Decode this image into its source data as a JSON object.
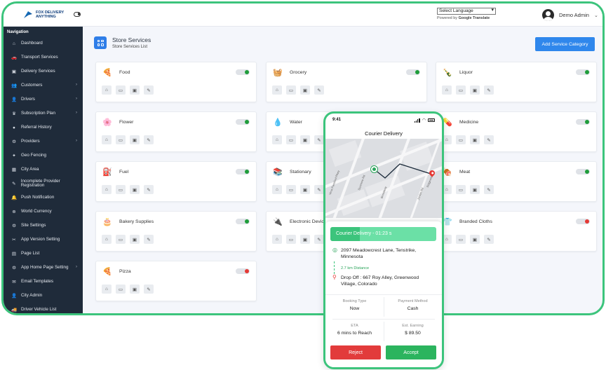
{
  "brand": {
    "logo_text": "FOX DELIVERY ANYTHING"
  },
  "header": {
    "language_select": "Select Language",
    "powered_by": "Powered by",
    "google_translate": "Google Translate",
    "user_name": "Demo Admin"
  },
  "sidebar": {
    "title": "Navigation",
    "items": [
      {
        "label": "Dashboard",
        "icon": "home-icon",
        "glyph": "⌂",
        "chevron": false
      },
      {
        "label": "Transport Services",
        "icon": "car-icon",
        "glyph": "🚗",
        "chevron": false
      },
      {
        "label": "Delivery Services",
        "icon": "box-icon",
        "glyph": "▣",
        "chevron": false
      },
      {
        "label": "Customers",
        "icon": "users-icon",
        "glyph": "👥",
        "chevron": true
      },
      {
        "label": "Drivers",
        "icon": "driver-icon",
        "glyph": "👤",
        "chevron": true
      },
      {
        "label": "Subscription Plan",
        "icon": "plan-icon",
        "glyph": "♛",
        "chevron": true
      },
      {
        "label": "Referral History",
        "icon": "referral-icon",
        "glyph": "●",
        "chevron": false
      },
      {
        "label": "Providers",
        "icon": "providers-icon",
        "glyph": "⚙",
        "chevron": true
      },
      {
        "label": "Geo Fencing",
        "icon": "geofence-icon",
        "glyph": "✦",
        "chevron": false
      },
      {
        "label": "City Area",
        "icon": "city-icon",
        "glyph": "▦",
        "chevron": false
      },
      {
        "label": "Incomplete Provider Registration",
        "icon": "incomplete-icon",
        "glyph": "✎",
        "chevron": false
      },
      {
        "label": "Push Notification",
        "icon": "bell-icon",
        "glyph": "🔔",
        "chevron": false
      },
      {
        "label": "World Currency",
        "icon": "currency-icon",
        "glyph": "⊕",
        "chevron": false
      },
      {
        "label": "Site Settings",
        "icon": "settings-icon",
        "glyph": "⚙",
        "chevron": false
      },
      {
        "label": "App Version Setting",
        "icon": "version-icon",
        "glyph": "✂",
        "chevron": false
      },
      {
        "label": "Page List",
        "icon": "page-icon",
        "glyph": "▤",
        "chevron": false
      },
      {
        "label": "App Home Page Setting",
        "icon": "app-home-icon",
        "glyph": "⚙",
        "chevron": true
      },
      {
        "label": "Email Templates",
        "icon": "email-icon",
        "glyph": "✉",
        "chevron": false
      },
      {
        "label": "City Admin",
        "icon": "city-admin-icon",
        "glyph": "👤",
        "chevron": false
      },
      {
        "label": "Driver Vehicle List",
        "icon": "vehicle-icon",
        "glyph": "🚚",
        "chevron": false
      }
    ]
  },
  "page": {
    "title": "Store Services",
    "subtitle": "Store Services List",
    "add_button": "Add Service Category"
  },
  "services": [
    {
      "name": "Food",
      "icon": "food-icon",
      "glyph": "🍕",
      "enabled": true
    },
    {
      "name": "Grocery",
      "icon": "grocery-icon",
      "glyph": "🧺",
      "enabled": true
    },
    {
      "name": "Liquor",
      "icon": "liquor-icon",
      "glyph": "🍾",
      "enabled": true
    },
    {
      "name": "Flower",
      "icon": "flower-icon",
      "glyph": "🌸",
      "enabled": true
    },
    {
      "name": "Water",
      "icon": "water-icon",
      "glyph": "💧",
      "enabled": true
    },
    {
      "name": "Medicine",
      "icon": "medicine-icon",
      "glyph": "💊",
      "enabled": true
    },
    {
      "name": "Fuel",
      "icon": "fuel-icon",
      "glyph": "⛽",
      "enabled": true
    },
    {
      "name": "Stationary",
      "icon": "stationary-icon",
      "glyph": "📚",
      "enabled": true
    },
    {
      "name": "Meat",
      "icon": "meat-icon",
      "glyph": "🍖",
      "enabled": true
    },
    {
      "name": "Bakery Supplies",
      "icon": "bakery-icon",
      "glyph": "🎂",
      "enabled": true
    },
    {
      "name": "Electronic Device",
      "icon": "electronic-icon",
      "glyph": "🔌",
      "enabled": true
    },
    {
      "name": "Branded Cloths",
      "icon": "cloths-icon",
      "glyph": "👕",
      "enabled": false
    },
    {
      "name": "Pizza",
      "icon": "pizza-icon",
      "glyph": "🍕",
      "enabled": false
    }
  ],
  "card_actions": [
    {
      "icon": "home-icon",
      "glyph": "⌂"
    },
    {
      "icon": "store-icon",
      "glyph": "▭"
    },
    {
      "icon": "briefcase-icon",
      "glyph": "▣"
    },
    {
      "icon": "edit-icon",
      "glyph": "✎"
    }
  ],
  "phone": {
    "time": "9:41",
    "title": "Courier Delivery",
    "map_streets": [
      "Veva Pansford Pkwy",
      "Dunmore Rd",
      "Broadway",
      "Jordan Rd",
      "Ridgeway St"
    ],
    "progress_text": "Courier Delivery - 01:23 s",
    "progress_fraction": 0.28,
    "pickup_address": "2097 Meadowcrest Lane, Tenstrike, Minnesota",
    "distance": "2.7 km Distance",
    "dropoff_address": "Drop Off : 667 Roy Alley, Greenwood Village, Colorado",
    "booking_type_label": "Booking Type",
    "booking_type": "Now",
    "payment_method_label": "Payment Method",
    "payment_method": "Cash",
    "eta_label": "ETA",
    "eta": "6 mins to Reach",
    "earning_label": "Est. Earning",
    "earning": "$ 89.50",
    "reject_label": "Reject",
    "accept_label": "Accept"
  },
  "colors": {
    "accent": "#3cc47c",
    "primary": "#2f87ec",
    "sidebar": "#1f2b3a",
    "on": "#1f9d3a",
    "off": "#e53935",
    "reject": "#e23b3b"
  }
}
